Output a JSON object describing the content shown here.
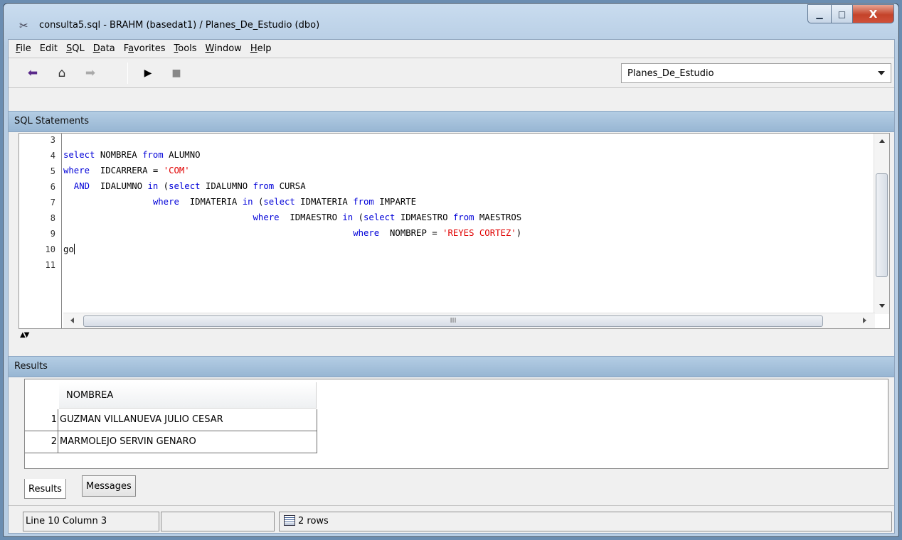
{
  "window": {
    "title": "consulta5.sql - BRAHM (basedat1) / Planes_De_Estudio (dbo)",
    "min_glyph": "▁",
    "max_glyph": "□",
    "close_glyph": "X"
  },
  "menu": [
    {
      "accel": "F",
      "rest": "ile"
    },
    {
      "accel": "",
      "rest": "Edit"
    },
    {
      "accel": "S",
      "rest": "QL"
    },
    {
      "accel": "D",
      "rest": "ata"
    },
    {
      "accel": "",
      "rest": "Favorites"
    },
    {
      "accel": "T",
      "rest": "ools"
    },
    {
      "accel": "W",
      "rest": "indow"
    },
    {
      "accel": "H",
      "rest": "elp"
    }
  ],
  "menu_pre": {
    "favorites_pre": "F",
    "favorites_accel": "a",
    "favorites_rest": "vorites"
  },
  "toolbar": {
    "back_icon": "⬅",
    "book_icon": "⌂",
    "forward_icon": "➡",
    "execute_icon": "▶",
    "stop_icon": "■",
    "database": "Planes_De_Estudio"
  },
  "sql_panel": {
    "header": "SQL Statements",
    "line_numbers": [
      "3",
      "4",
      "5",
      "6",
      "7",
      "8",
      "9",
      "10",
      "11"
    ],
    "lines": [
      [],
      [
        {
          "t": "select",
          "c": "kw"
        },
        {
          "t": " NOMBREA "
        },
        {
          "t": "from",
          "c": "kw"
        },
        {
          "t": " ALUMNO"
        }
      ],
      [
        {
          "t": "where",
          "c": "kw"
        },
        {
          "t": "  IDCARRERA = "
        },
        {
          "t": "'COM'",
          "c": "str"
        }
      ],
      [
        {
          "t": "  AND",
          "c": "kw"
        },
        {
          "t": "  IDALUMNO "
        },
        {
          "t": "in",
          "c": "kw"
        },
        {
          "t": " ("
        },
        {
          "t": "select",
          "c": "kw"
        },
        {
          "t": " IDALUMNO "
        },
        {
          "t": "from",
          "c": "kw"
        },
        {
          "t": " CURSA"
        }
      ],
      [
        {
          "t": "                 "
        },
        {
          "t": "where",
          "c": "kw"
        },
        {
          "t": "  IDMATERIA "
        },
        {
          "t": "in",
          "c": "kw"
        },
        {
          "t": " ("
        },
        {
          "t": "select",
          "c": "kw"
        },
        {
          "t": " IDMATERIA "
        },
        {
          "t": "from",
          "c": "kw"
        },
        {
          "t": " IMPARTE"
        }
      ],
      [
        {
          "t": "                                    "
        },
        {
          "t": "where",
          "c": "kw"
        },
        {
          "t": "  IDMAESTRO "
        },
        {
          "t": "in",
          "c": "kw"
        },
        {
          "t": " ("
        },
        {
          "t": "select",
          "c": "kw"
        },
        {
          "t": " IDMAESTRO "
        },
        {
          "t": "from",
          "c": "kw"
        },
        {
          "t": " MAESTROS"
        }
      ],
      [
        {
          "t": "                                                       "
        },
        {
          "t": "where",
          "c": "kw"
        },
        {
          "t": "  NOMBREP = "
        },
        {
          "t": "'REYES CORTEZ'",
          "c": "str"
        },
        {
          "t": ")"
        }
      ],
      [
        {
          "t": "go"
        }
      ],
      []
    ],
    "hscroll_grip": "III"
  },
  "results_panel": {
    "header": "Results",
    "column": "NOMBREA",
    "rows": [
      {
        "n": "1",
        "v": "GUZMAN VILLANUEVA JULIO CESAR"
      },
      {
        "n": "2",
        "v": "MARMOLEJO SERVIN GENARO"
      }
    ]
  },
  "tabs": {
    "results": "Results",
    "messages": "Messages"
  },
  "status": {
    "position": "Line 10  Column 3",
    "empty": "",
    "rows": "2 rows"
  }
}
